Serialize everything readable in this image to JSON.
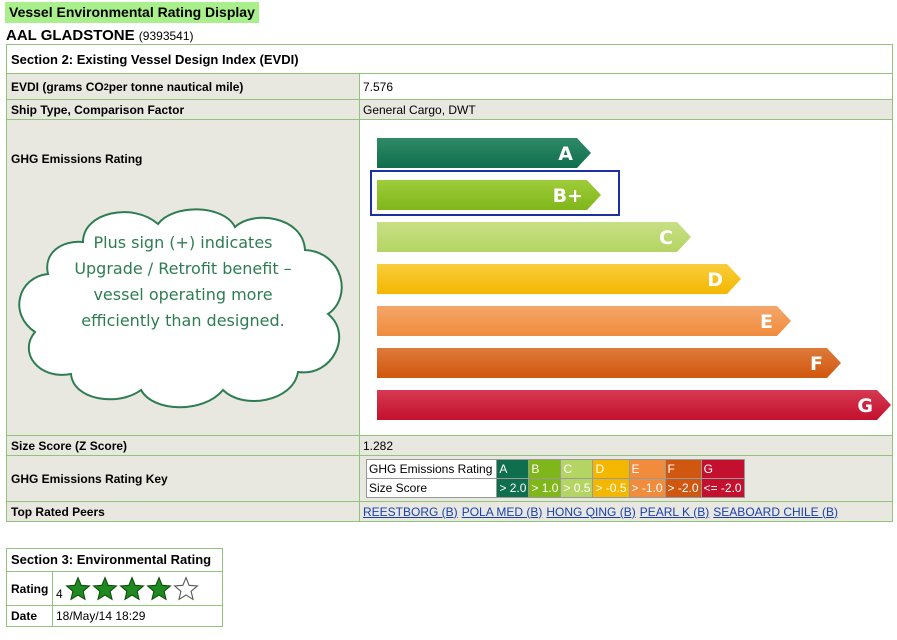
{
  "page_title": "Vessel Environmental Rating Display",
  "vessel": {
    "name": "AAL GLADSTONE",
    "imo": "(9393541)"
  },
  "section2": {
    "header": "Section 2: Existing Vessel Design Index (EVDI)",
    "evdi_label_pre": "EVDI (grams CO",
    "evdi_label_sub": "2",
    "evdi_label_post": " per tonne nautical mile)",
    "evdi_value": "7.576",
    "ship_type_label": "Ship Type, Comparison Factor",
    "ship_type_value": "General Cargo, DWT",
    "ghg_label": "GHG Emissions Rating",
    "cloud_text": "Plus sign (+) indicates Upgrade / Retrofit benefit – vessel operating more efficiently than designed.",
    "rating_bars": [
      {
        "label": "A",
        "color": "#0f6e4e",
        "color2": "#2f8a66"
      },
      {
        "label": "B+",
        "color": "#7fb61a",
        "color2": "#a0cc3a",
        "selected": true
      },
      {
        "label": "C",
        "color": "#b4d463",
        "color2": "#c8e085"
      },
      {
        "label": "D",
        "color": "#f4b700",
        "color2": "#f8cd3c"
      },
      {
        "label": "E",
        "color": "#f08c3c",
        "color2": "#f4a66a"
      },
      {
        "label": "F",
        "color": "#d0570f",
        "color2": "#de7a3a"
      },
      {
        "label": "G",
        "color": "#c3102e",
        "color2": "#d63a52"
      }
    ],
    "selected_color": "#1e2f9e",
    "size_score_label": "Size Score (Z Score)",
    "size_score_value": "1.282",
    "key_label": "GHG Emissions Rating Key",
    "key_row1_label": "GHG Emissions Rating",
    "key_row2_label": "Size Score",
    "key": [
      {
        "grade": "A",
        "score": "> 2.0",
        "color": "#0f6e4e"
      },
      {
        "grade": "B",
        "score": "> 1.0",
        "color": "#7fb61a"
      },
      {
        "grade": "C",
        "score": "> 0.5",
        "color": "#b4d463"
      },
      {
        "grade": "D",
        "score": "> -0.5",
        "color": "#f4b700"
      },
      {
        "grade": "E",
        "score": "> -1.0",
        "color": "#f08c3c"
      },
      {
        "grade": "F",
        "score": "> -2.0",
        "color": "#d0570f"
      },
      {
        "grade": "G",
        "score": "<= -2.0",
        "color": "#c3102e"
      }
    ],
    "peers_label": "Top Rated Peers",
    "peers": [
      "REESTBORG (B)",
      "POLA MED (B)",
      "HONG QING (B)",
      "PEARL K (B)",
      "SEABOARD CHILE (B)"
    ]
  },
  "section3": {
    "header": "Section 3: Environmental Rating",
    "rating_label": "Rating",
    "rating_value": "4",
    "stars_filled": 4,
    "stars_total": 5,
    "star_color": "#1f8a1f",
    "date_label": "Date",
    "date_value": "18/May/14 18:29"
  }
}
